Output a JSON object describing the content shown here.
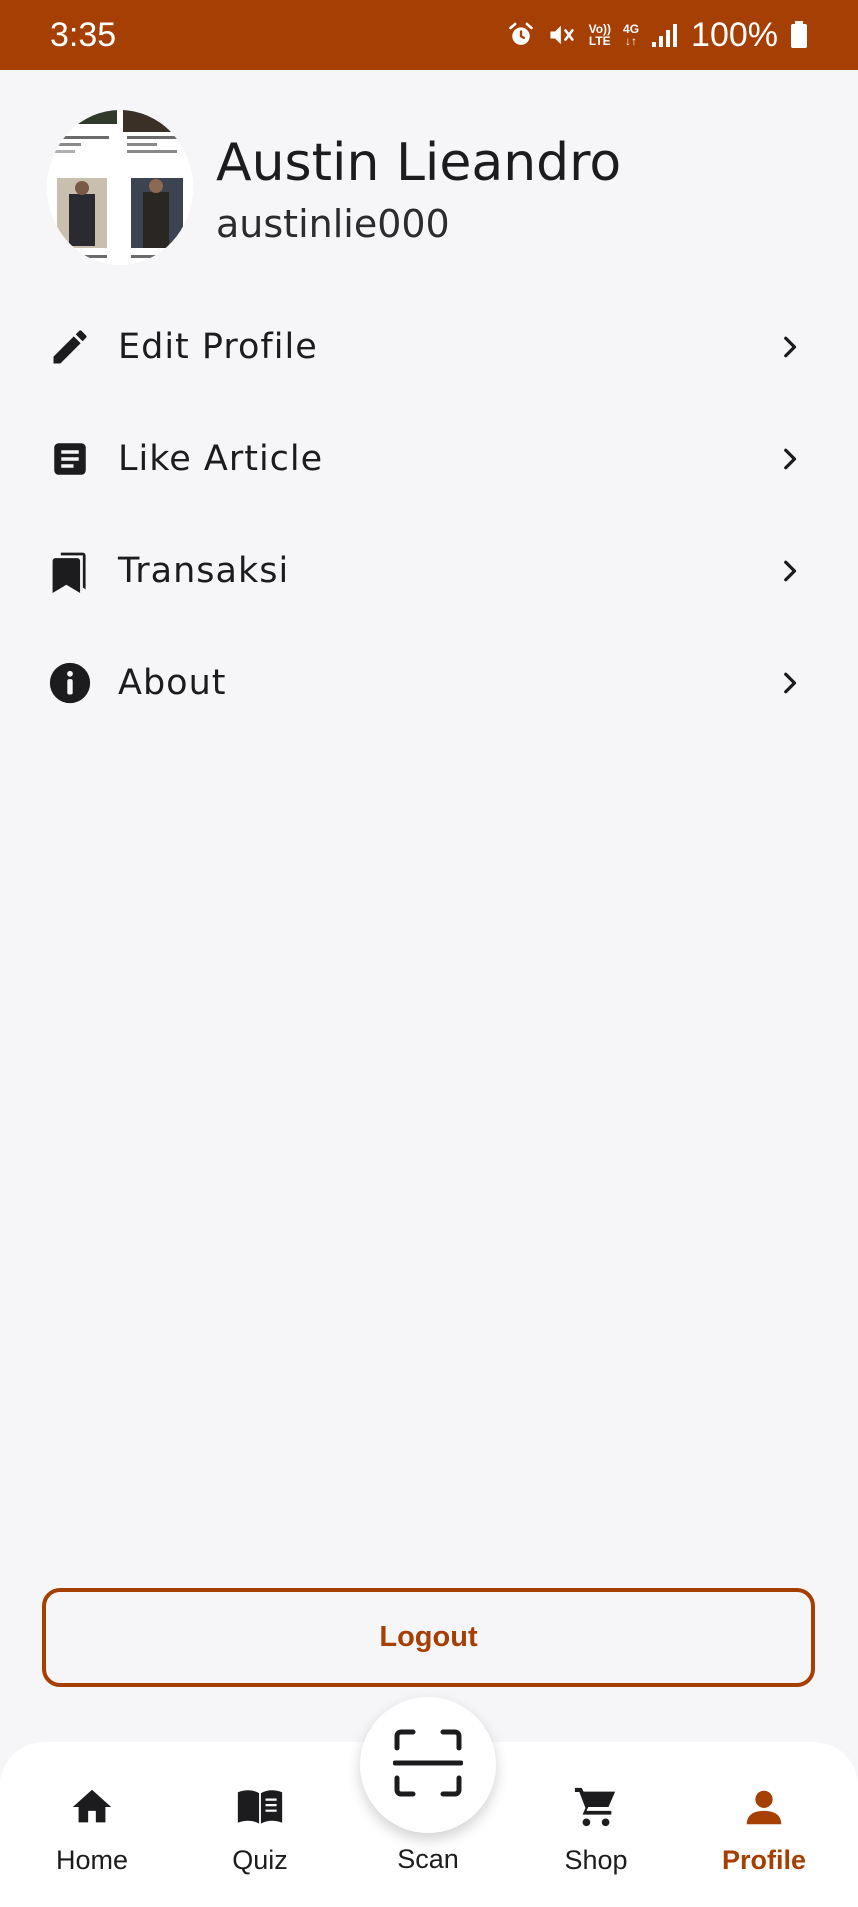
{
  "status_bar": {
    "time": "3:35",
    "volte_top": "Vo))",
    "volte_bottom": "LTE",
    "network_top": "4G",
    "network_bottom": "↓↑",
    "battery": "100%",
    "icons": [
      "alarm-icon",
      "mute-icon",
      "volte-icon",
      "network-4g-icon",
      "signal-icon",
      "battery-icon"
    ]
  },
  "profile": {
    "name": "Austin Lieandro",
    "username": "austinlie000"
  },
  "menu": [
    {
      "label": "Edit Profile",
      "icon": "pencil-icon"
    },
    {
      "label": "Like Article",
      "icon": "article-icon"
    },
    {
      "label": "Transaksi",
      "icon": "bookmarks-icon"
    },
    {
      "label": "About",
      "icon": "info-icon"
    }
  ],
  "logout_label": "Logout",
  "bottom_nav": {
    "items": [
      {
        "label": "Home",
        "icon": "home-icon",
        "active": false
      },
      {
        "label": "Quiz",
        "icon": "book-icon",
        "active": false
      },
      {
        "label": "Scan",
        "icon": "scan-icon",
        "active": false
      },
      {
        "label": "Shop",
        "icon": "cart-icon",
        "active": false
      },
      {
        "label": "Profile",
        "icon": "person-icon",
        "active": true
      }
    ]
  },
  "colors": {
    "brand": "#a63f03",
    "background": "#f6f6f9",
    "text": "#1c1c1e"
  }
}
